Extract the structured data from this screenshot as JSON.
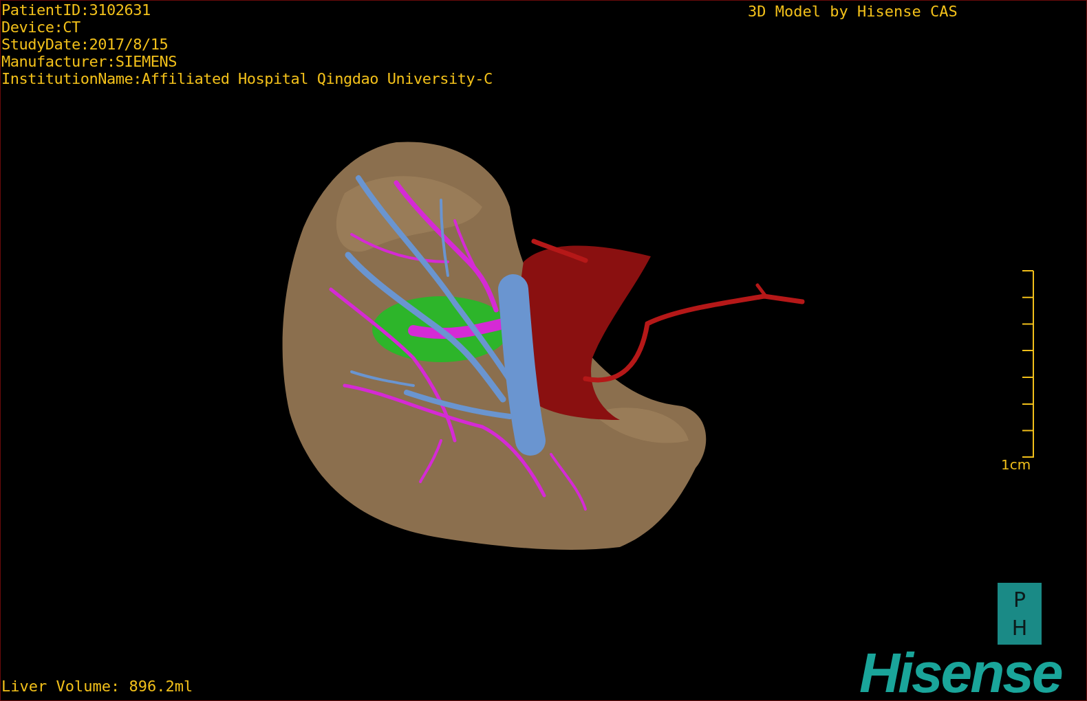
{
  "study_info": [
    "PatientID:3102631",
    "Device:CT",
    "StudyDate:2017/8/15",
    "Manufacturer:SIEMENS",
    "InstitutionName:Affiliated Hospital Qingdao University-C"
  ],
  "model_credit": "3D Model by Hisense CAS",
  "scale_bar": {
    "label": "1cm"
  },
  "orientation_marker": [
    "P",
    "H"
  ],
  "logo": "Hisense",
  "liver_volume": "Liver Volume: 896.2ml"
}
